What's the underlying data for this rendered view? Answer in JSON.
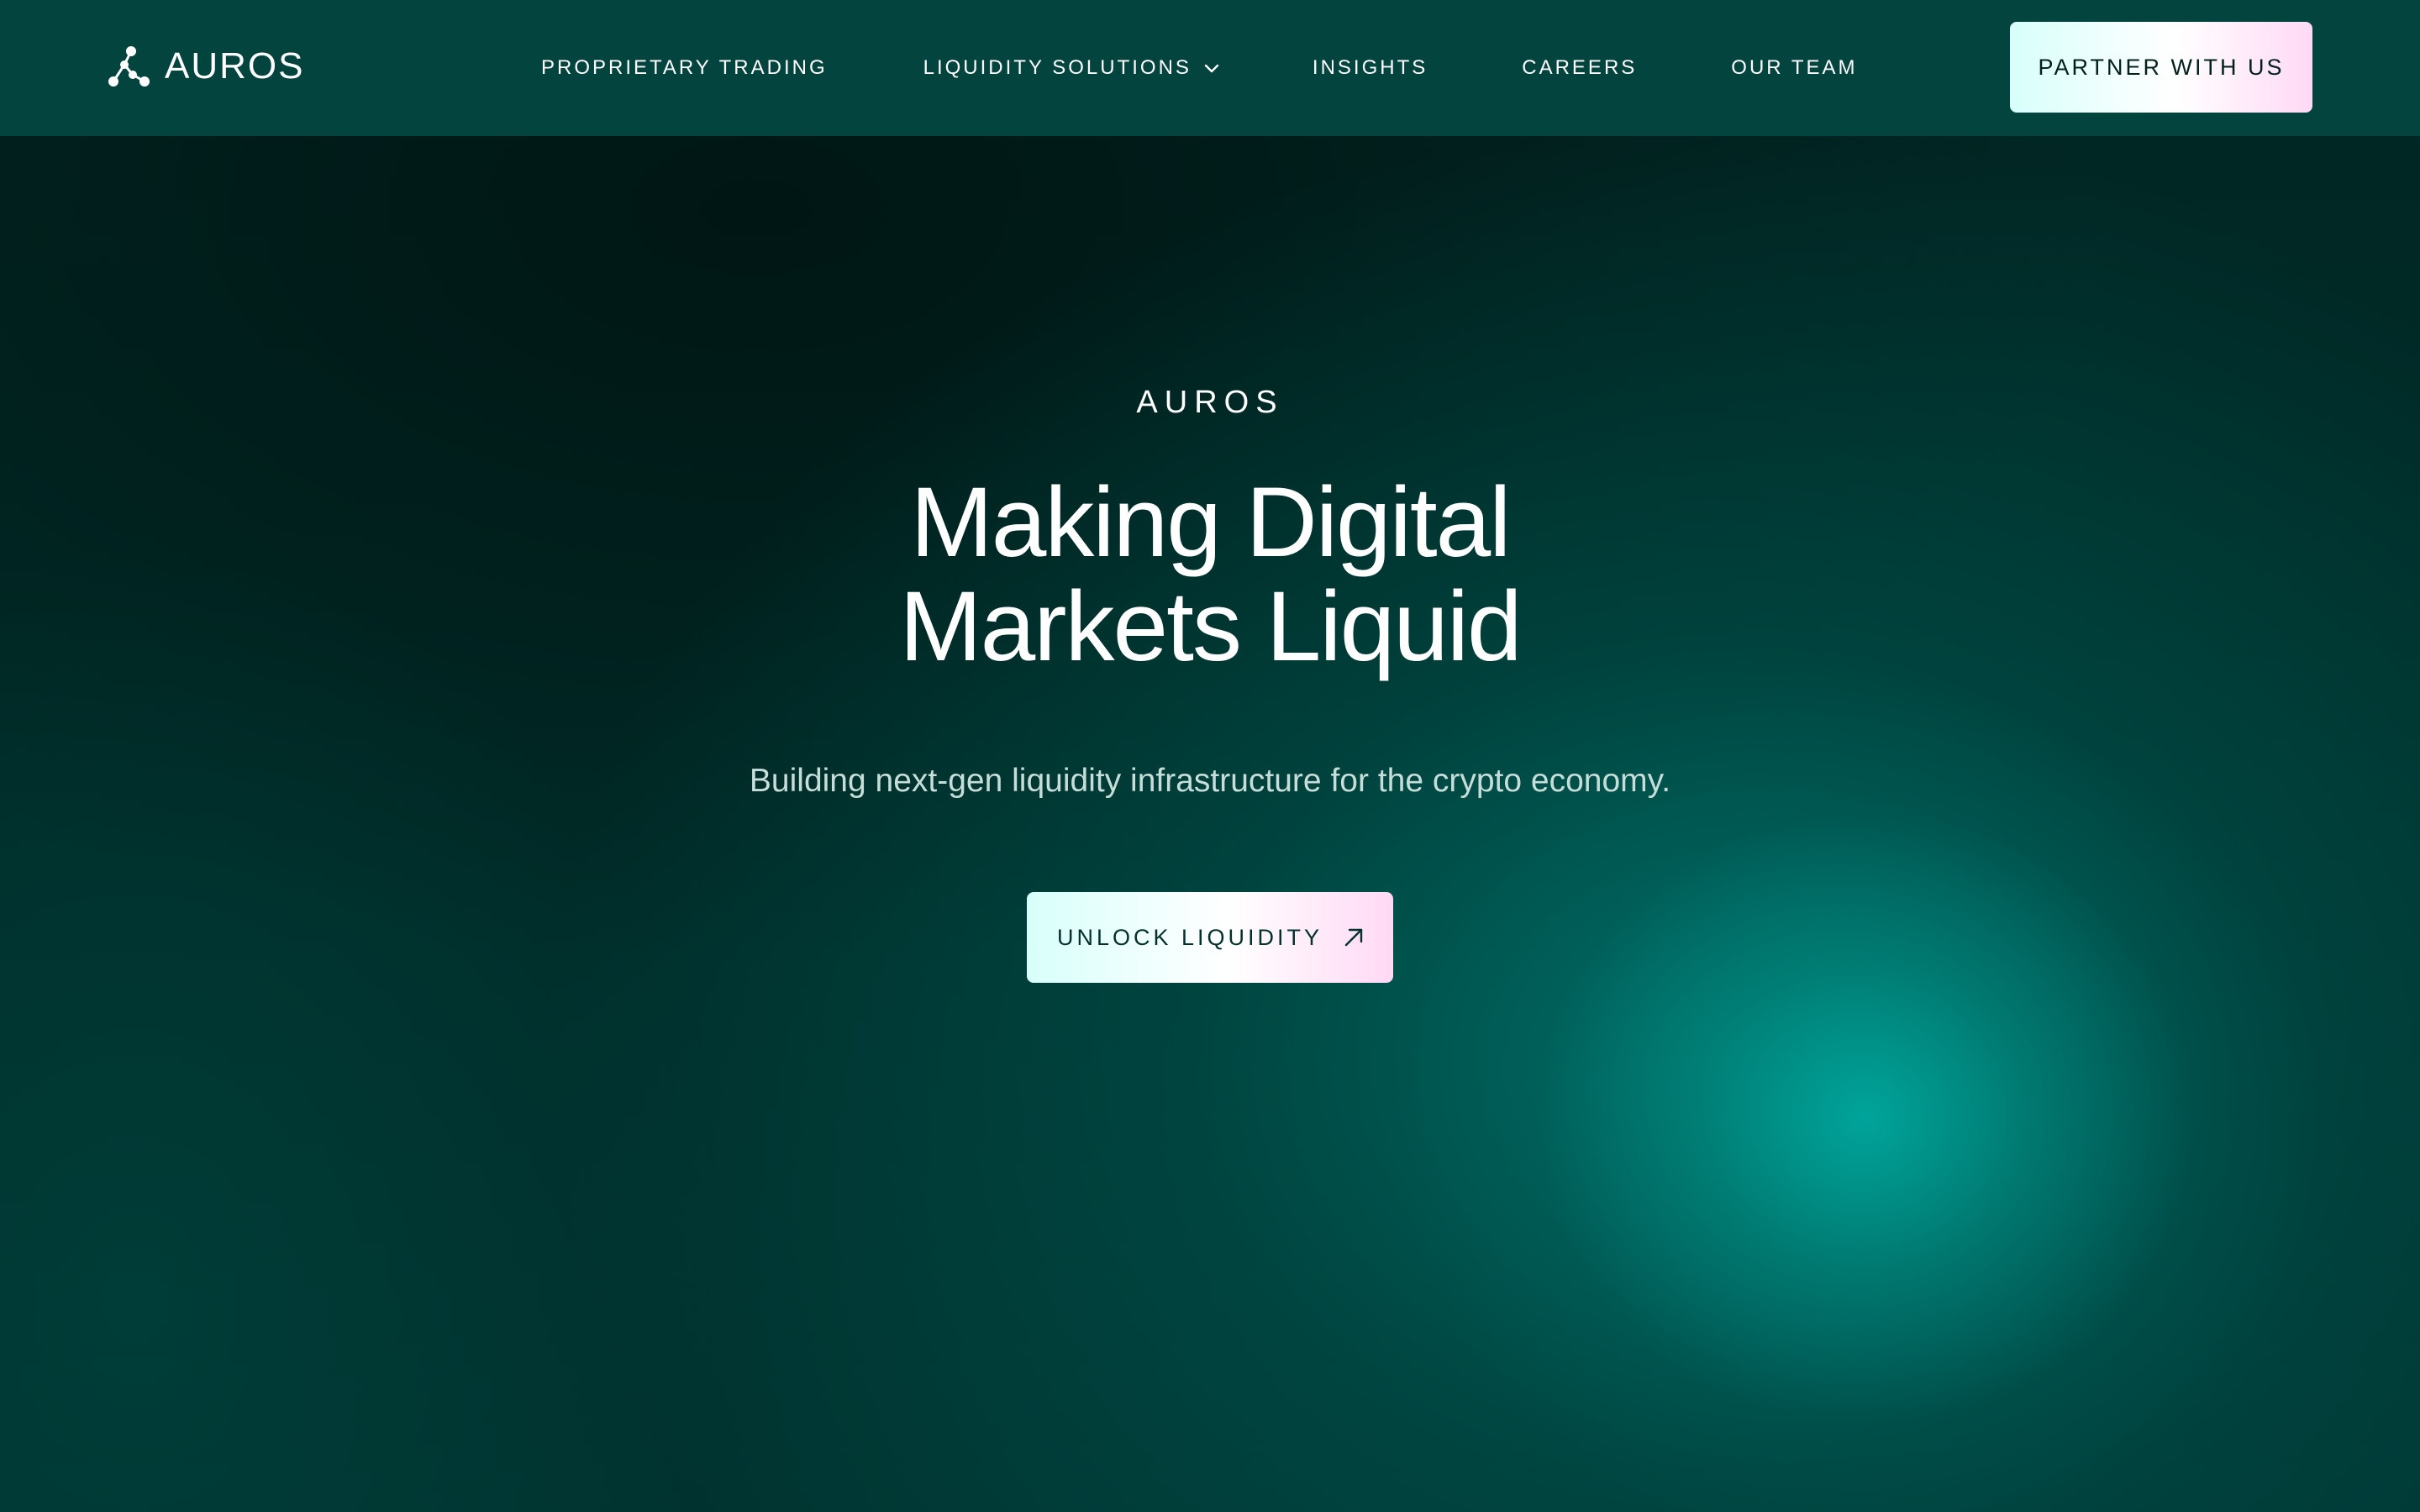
{
  "brand": {
    "name": "AUROS",
    "logo_icon": "auros-molecule-icon"
  },
  "nav": {
    "links": [
      {
        "label": "PROPRIETARY TRADING"
      },
      {
        "label": "LIQUIDITY SOLUTIONS",
        "has_dropdown": true,
        "icon": "chevron-down-icon"
      },
      {
        "label": "INSIGHTS"
      },
      {
        "label": "CAREERS"
      },
      {
        "label": "OUR TEAM"
      }
    ],
    "cta_label": "PARTNER WITH US"
  },
  "hero": {
    "eyebrow": "AUROS",
    "headline_line1": "Making Digital",
    "headline_line2": "Markets Liquid",
    "subhead": "Building next-gen liquidity infrastructure for the crypto economy.",
    "cta_label": "UNLOCK LIQUIDITY",
    "cta_icon": "arrow-up-right-icon"
  },
  "colors": {
    "nav_bg": "#03443f",
    "accent_teal": "#00a89e",
    "button_gradient_start": "#d8fffb",
    "button_gradient_end": "#ffd9f5",
    "text_primary": "#ffffff",
    "text_secondary": "#c6ded9"
  }
}
